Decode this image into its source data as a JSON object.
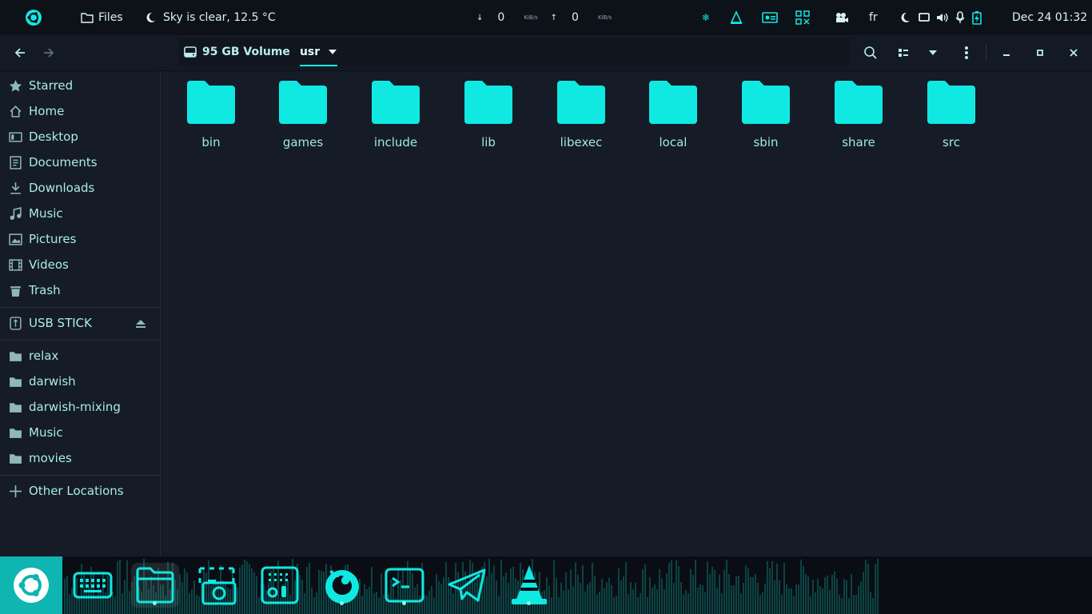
{
  "colors": {
    "accent": "#10e8e2",
    "panel": "#0d1118",
    "window": "#151b27",
    "text": "#a9ece8"
  },
  "topbar": {
    "app_name": "Files",
    "weather": "Sky is clear, 12.5 °C",
    "net_down": "0",
    "net_up": "0",
    "net_unit_down": "KiB/s",
    "net_unit_up": "KiB/s",
    "keyboard_layout": "fr",
    "datetime": "Dec 24  01:32"
  },
  "headerbar": {
    "volume_label": "95 GB Volume",
    "current_folder": "usr"
  },
  "sidebar": {
    "places": [
      {
        "label": "Starred",
        "icon": "star-icon"
      },
      {
        "label": "Home",
        "icon": "home-icon"
      },
      {
        "label": "Desktop",
        "icon": "desktop-icon"
      },
      {
        "label": "Documents",
        "icon": "documents-icon"
      },
      {
        "label": "Downloads",
        "icon": "downloads-icon"
      },
      {
        "label": "Music",
        "icon": "music-icon"
      },
      {
        "label": "Pictures",
        "icon": "pictures-icon"
      },
      {
        "label": "Videos",
        "icon": "videos-icon"
      },
      {
        "label": "Trash",
        "icon": "trash-icon"
      }
    ],
    "devices": [
      {
        "label": "USB STICK",
        "icon": "usb-icon"
      }
    ],
    "bookmarks": [
      {
        "label": "relax",
        "icon": "folder-icon"
      },
      {
        "label": "darwish",
        "icon": "folder-icon"
      },
      {
        "label": "darwish-mixing",
        "icon": "folder-icon"
      },
      {
        "label": "Music",
        "icon": "folder-icon"
      },
      {
        "label": "movies",
        "icon": "folder-icon"
      }
    ],
    "other_locations": "Other Locations"
  },
  "files": [
    {
      "name": "bin"
    },
    {
      "name": "games"
    },
    {
      "name": "include"
    },
    {
      "name": "lib"
    },
    {
      "name": "libexec"
    },
    {
      "name": "local"
    },
    {
      "name": "sbin"
    },
    {
      "name": "share"
    },
    {
      "name": "src"
    }
  ],
  "dock": {
    "apps": [
      {
        "name": "ubuntu-menu",
        "running": false
      },
      {
        "name": "keyboard-app",
        "running": false
      },
      {
        "name": "files-app",
        "running": true
      },
      {
        "name": "screenshot-app",
        "running": false
      },
      {
        "name": "mixer-app",
        "running": false
      },
      {
        "name": "firefox-app",
        "running": true
      },
      {
        "name": "terminal-app",
        "running": true
      },
      {
        "name": "telegram-app",
        "running": false
      },
      {
        "name": "vlc-app",
        "running": true
      }
    ]
  }
}
